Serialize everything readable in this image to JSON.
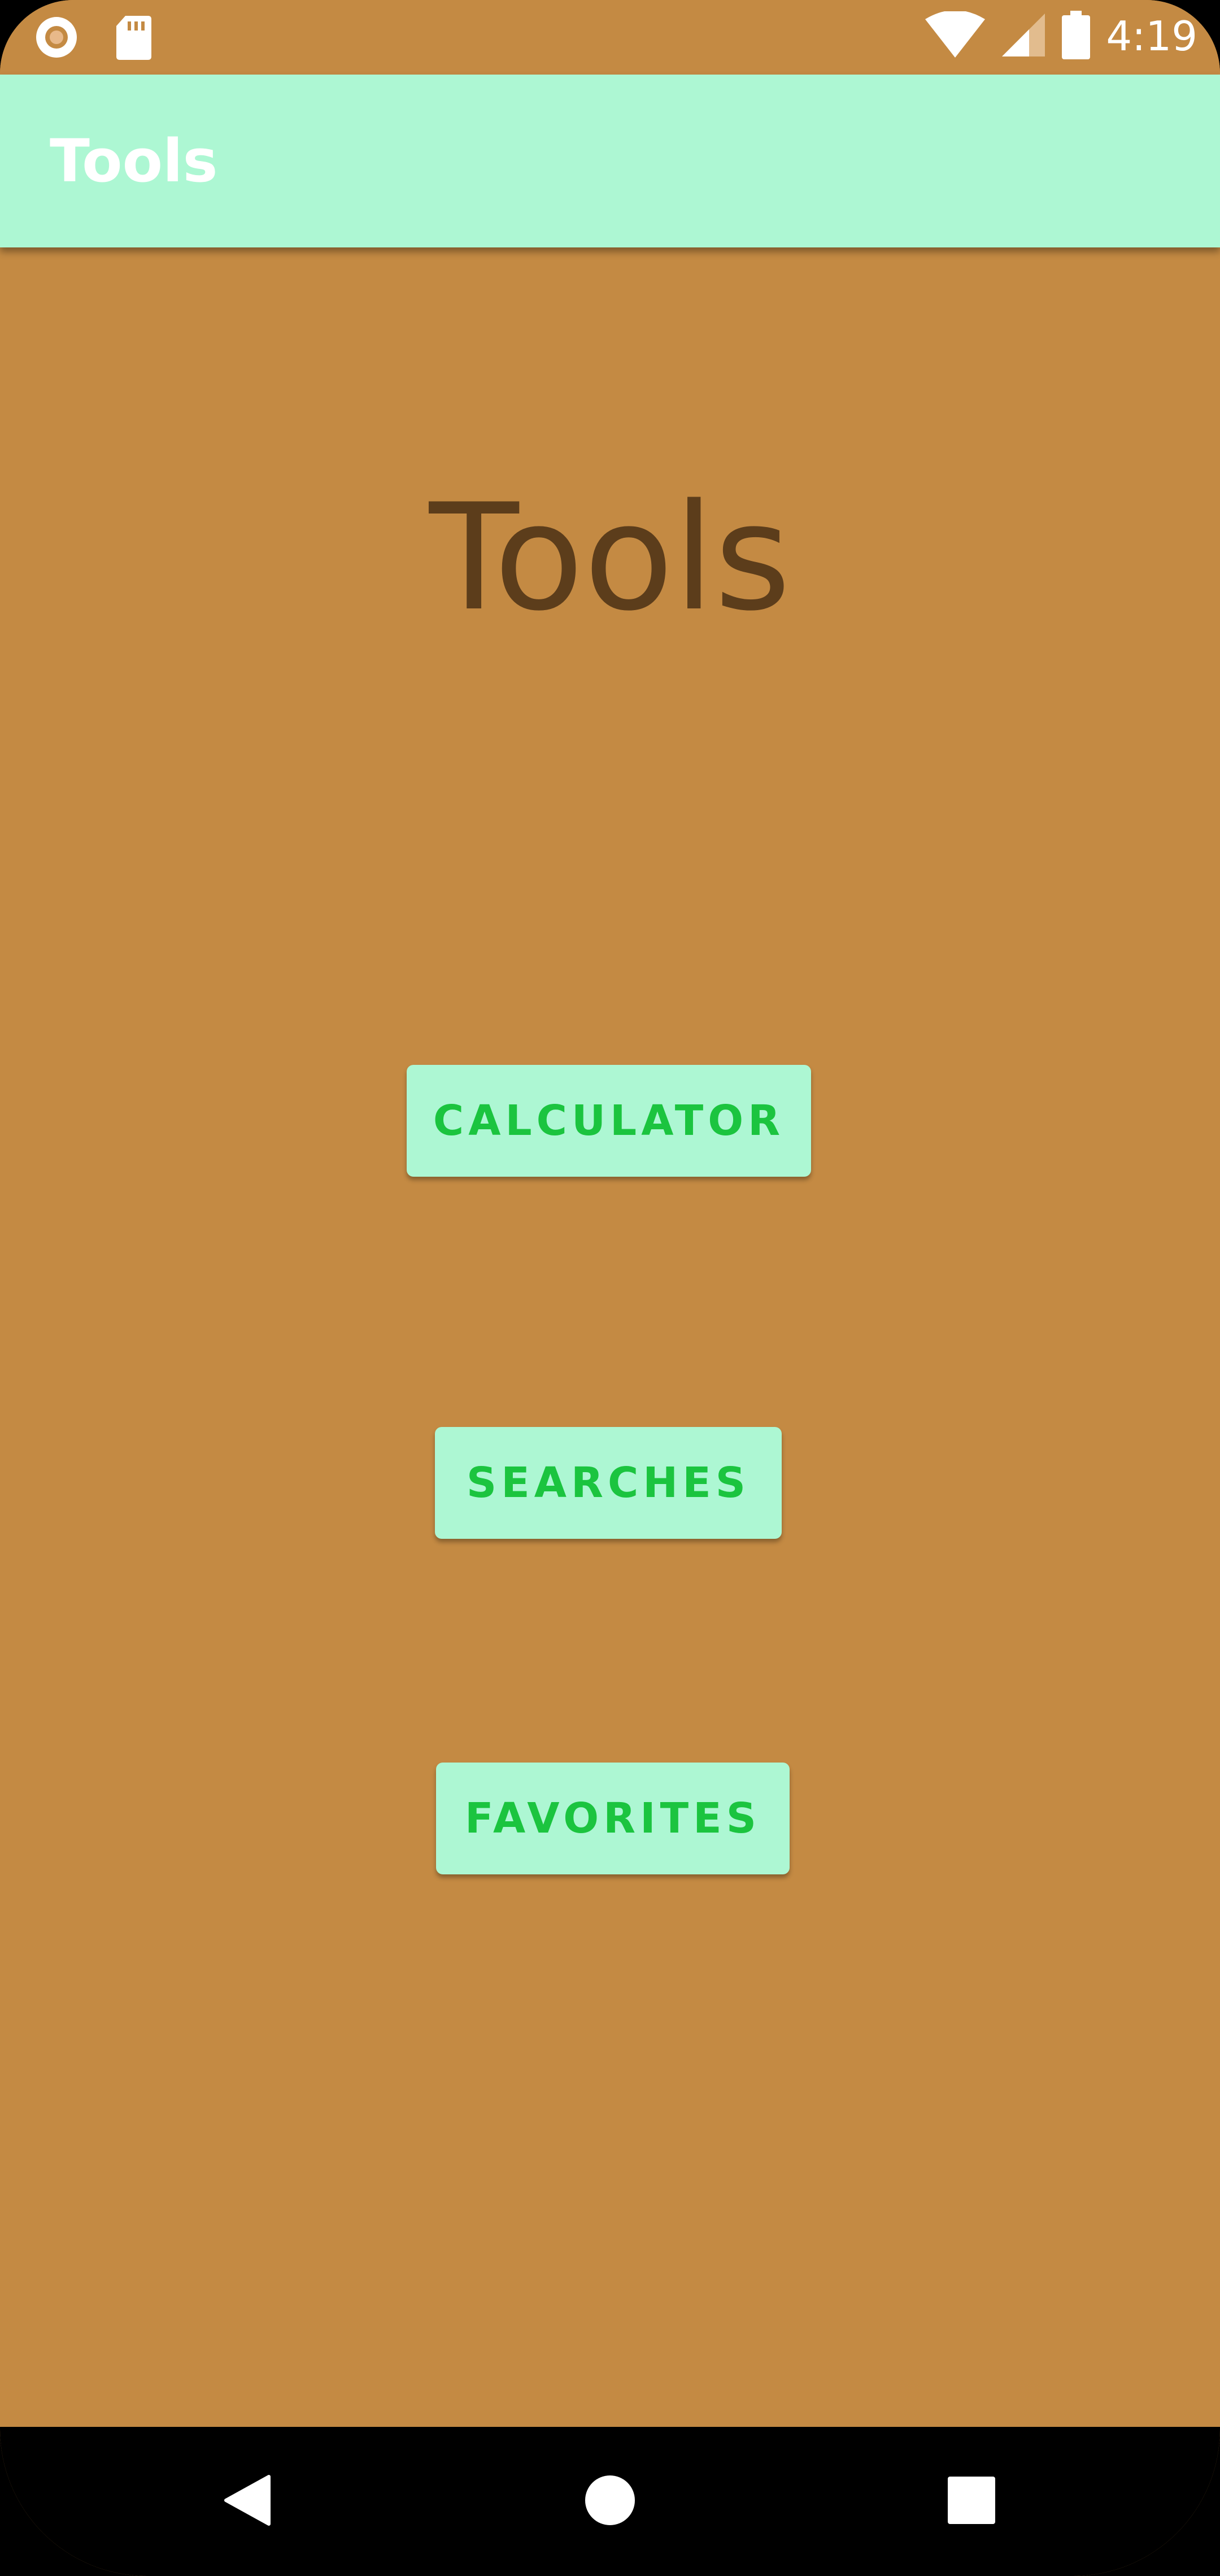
{
  "status_bar": {
    "time": "4:19",
    "icons": [
      "circle-notification-icon",
      "sd-card-icon",
      "wifi-icon",
      "cell-signal-icon",
      "battery-icon"
    ]
  },
  "app_bar": {
    "title": "Tools"
  },
  "main": {
    "heading": "Tools",
    "buttons": {
      "calculator": "CALCULATOR",
      "searches": "SEARCHES",
      "favorites": "FAVORITES"
    }
  },
  "nav_bar": {
    "icons": [
      "back-icon",
      "home-icon",
      "recents-icon"
    ]
  },
  "colors": {
    "background": "#c48a43",
    "app_bar": "#adf7d3",
    "button_text": "#1bc43f",
    "heading_text": "#5c3d1b"
  }
}
